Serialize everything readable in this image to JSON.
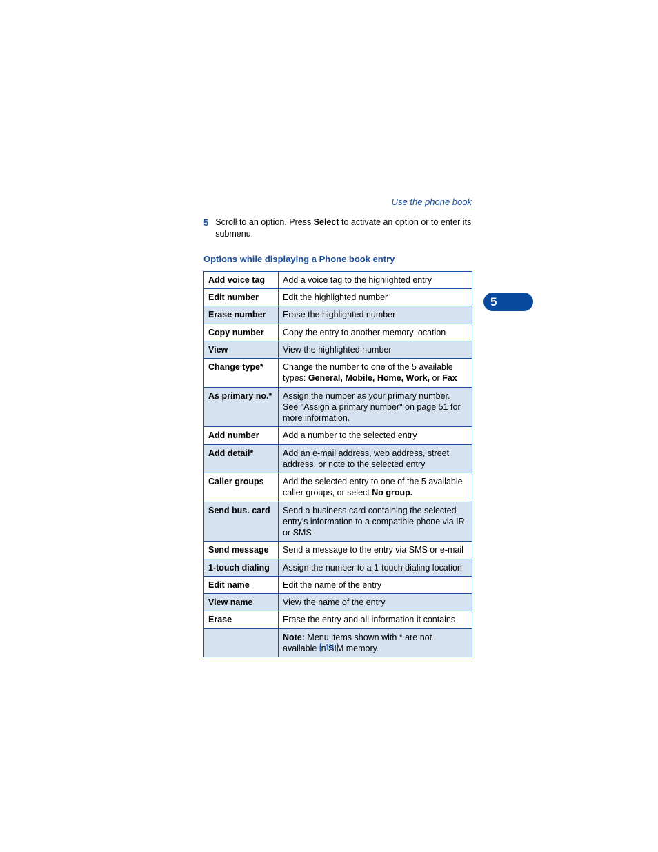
{
  "header": {
    "section_link": "Use the phone book"
  },
  "step": {
    "number": "5",
    "text_before": "Scroll to an option. Press ",
    "bold_word": "Select",
    "text_after": " to activate an option or to enter its submenu."
  },
  "section_title": "Options while displaying a Phone book entry",
  "rows": [
    {
      "option": "Add voice tag",
      "desc": "Add a voice tag to the highlighted entry",
      "shaded": false
    },
    {
      "option": "Edit number",
      "desc": "Edit the highlighted number",
      "shaded": false
    },
    {
      "option": "Erase number",
      "desc": "Erase the highlighted number",
      "shaded": true
    },
    {
      "option": "Copy number",
      "desc": "Copy the entry to another memory location",
      "shaded": false
    },
    {
      "option": "View",
      "desc": "View the highlighted number",
      "shaded": true
    },
    {
      "option": "Change type*",
      "desc_before": "Change the number to one of the 5 available types: ",
      "bolds": "General, Mobile, Home, Work,",
      "desc_after": " or ",
      "bolds2": "Fax",
      "shaded": false
    },
    {
      "option": "As primary no.*",
      "desc": "Assign the number as your primary number. See \"Assign a primary number\" on page 51 for more information.",
      "shaded": true
    },
    {
      "option": "Add number",
      "desc": "Add a number to the selected entry",
      "shaded": false
    },
    {
      "option": "Add detail*",
      "desc": "Add an e-mail address, web address, street address, or note to the selected entry",
      "shaded": true
    },
    {
      "option": "Caller groups",
      "desc_before": "Add the selected entry to one of the 5 available caller groups, or select ",
      "bolds": "No group.",
      "shaded": false
    },
    {
      "option": "Send bus. card",
      "desc": "Send a business card containing the selected entry's information to a compatible phone via IR or SMS",
      "shaded": true
    },
    {
      "option": "Send message",
      "desc": "Send a message to the entry via SMS or e-mail",
      "shaded": false
    },
    {
      "option": "1-touch dialing",
      "desc": "Assign the number to a 1-touch dialing location",
      "shaded": true
    },
    {
      "option": "Edit name",
      "desc": "Edit the name of the entry",
      "shaded": false
    },
    {
      "option": "View name",
      "desc": "View the name of the entry",
      "shaded": true
    },
    {
      "option": "Erase",
      "desc": "Erase the entry and all information it contains",
      "shaded": false
    }
  ],
  "note": {
    "label": "Note:",
    "text": " Menu items shown with * are not available in SIM memory."
  },
  "tab_number": "5",
  "page_number": "[ 49 ]"
}
